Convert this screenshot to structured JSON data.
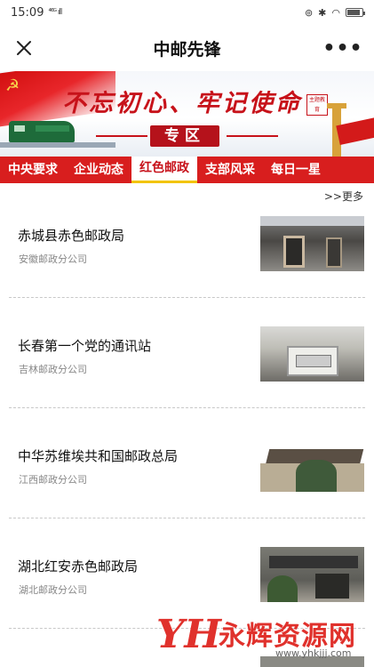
{
  "status_bar": {
    "time": "15:09",
    "signal": "⁴⁶ᴳ ıll"
  },
  "header": {
    "title": "中邮先锋",
    "close_icon": "close-icon",
    "more_icon": "more-dots-icon",
    "more_label": "•••"
  },
  "banner": {
    "slogan": "不忘初心、牢记使命",
    "seal_text": "主题教育",
    "zone_label": "专区",
    "accent_color": "#c7121a"
  },
  "tabs": [
    {
      "label": "中央要求",
      "active": false
    },
    {
      "label": "企业动态",
      "active": false
    },
    {
      "label": "红色邮政",
      "active": true
    },
    {
      "label": "支部风采",
      "active": false
    },
    {
      "label": "每日一星",
      "active": false
    }
  ],
  "more_link": ">>更多",
  "items": [
    {
      "title": "赤城县赤色邮政局",
      "source": "安徽邮政分公司"
    },
    {
      "title": "长春第一个党的通讯站",
      "source": "吉林邮政分公司"
    },
    {
      "title": "中华苏维埃共和国邮政总局",
      "source": "江西邮政分公司"
    },
    {
      "title": "湖北红安赤色邮政局",
      "source": "湖北邮政分公司"
    }
  ],
  "watermark": {
    "logo": "YH",
    "name": "永辉资源网",
    "url": "www.yhkjjj.com"
  }
}
